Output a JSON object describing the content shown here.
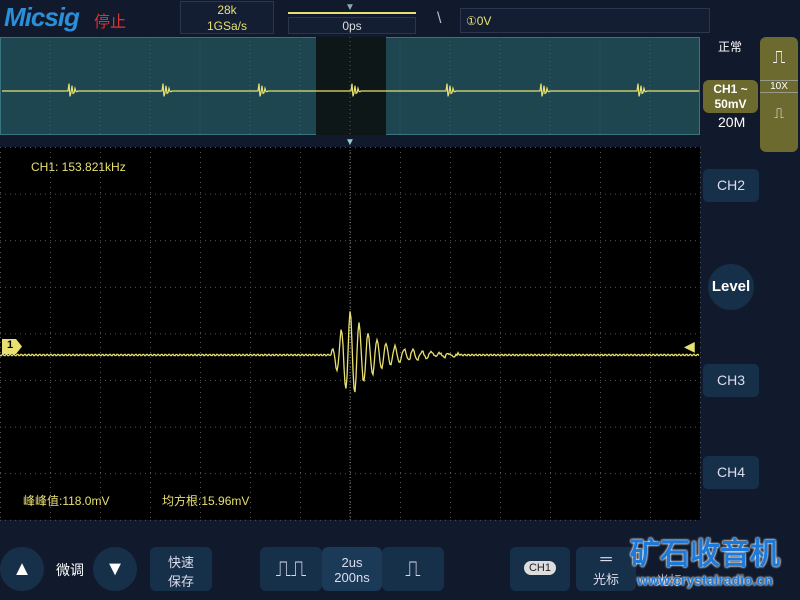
{
  "header": {
    "brand": "Micsig",
    "state_label": "停止",
    "record_length": "28k",
    "sample_rate": "1GSa/s",
    "time_position": "0ps",
    "trigger_edge": "\\",
    "trigger_level": "①0V"
  },
  "measurements": {
    "frequency": "CH1: 153.821kHz",
    "peak_to_peak": "峰峰值:118.0mV",
    "rms": "均方根:15.96mV"
  },
  "right_panel": {
    "trigger_mode": "正常",
    "ch1_label": "CH1 ~",
    "ch1_scale": "50mV",
    "bandwidth": "20M",
    "probe": "10X",
    "ch2": "CH2",
    "level": "Level",
    "ch3": "CH3",
    "ch4": "CH4",
    "ch1_marker": "1"
  },
  "bottom": {
    "fine_adjust": "微调",
    "quick_save_1": "快速",
    "quick_save_2": "保存",
    "timebase": "2us",
    "timebase_fine": "200ns",
    "ch1_button": "CH1",
    "cursor": "光标",
    "cursor2": "光标"
  },
  "watermark": {
    "title": "矿石收音机",
    "url": "www.crystalradio.cn"
  },
  "colors": {
    "trace": "#e8e070",
    "accent": "#2a8fd8"
  }
}
